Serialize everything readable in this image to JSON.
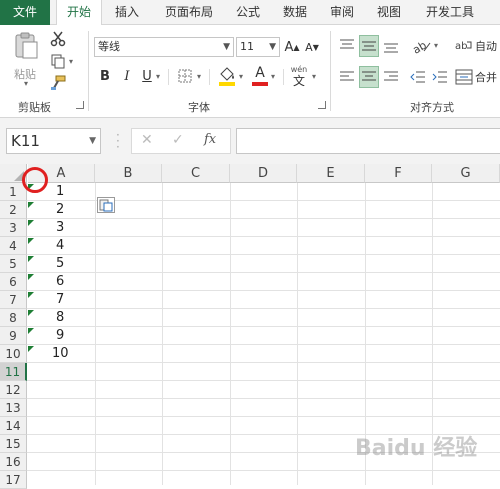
{
  "tabs": [
    {
      "label": "文件"
    },
    {
      "label": "开始"
    },
    {
      "label": "插入"
    },
    {
      "label": "页面布局"
    },
    {
      "label": "公式"
    },
    {
      "label": "数据"
    },
    {
      "label": "审阅"
    },
    {
      "label": "视图"
    },
    {
      "label": "开发工具"
    }
  ],
  "clipboard": {
    "paste_label": "粘贴",
    "group_label": "剪贴板"
  },
  "font": {
    "name": "等线",
    "size": "11",
    "group_label": "字体",
    "bold": "B",
    "italic": "I",
    "underline": "U",
    "font_color": "A",
    "wen_label": "wén",
    "wen_char": "文",
    "grow": "A",
    "shrink": "A",
    "fx": "fx"
  },
  "alignment": {
    "wrap_label": "自动",
    "merge_label": "合并",
    "group_label": "对齐方式"
  },
  "formula_bar": {
    "name_box": "K11",
    "fx": "fx",
    "content": ""
  },
  "columns": [
    "A",
    "B",
    "C",
    "D",
    "E",
    "F",
    "G"
  ],
  "rows": [
    "1",
    "2",
    "3",
    "4",
    "5",
    "6",
    "7",
    "8",
    "9",
    "10",
    "11",
    "12",
    "13",
    "14",
    "15",
    "16",
    "17"
  ],
  "column_a_values": [
    "1",
    "2",
    "3",
    "4",
    "5",
    "6",
    "7",
    "8",
    "9",
    "10"
  ],
  "active_row": "11",
  "colors": {
    "excel_green": "#217346",
    "triangle_green": "#1e7e34",
    "annotation_red": "#e02020",
    "fill_yellow": "#ffd800",
    "font_red": "#e02020"
  },
  "watermark": "Baidu 经验"
}
